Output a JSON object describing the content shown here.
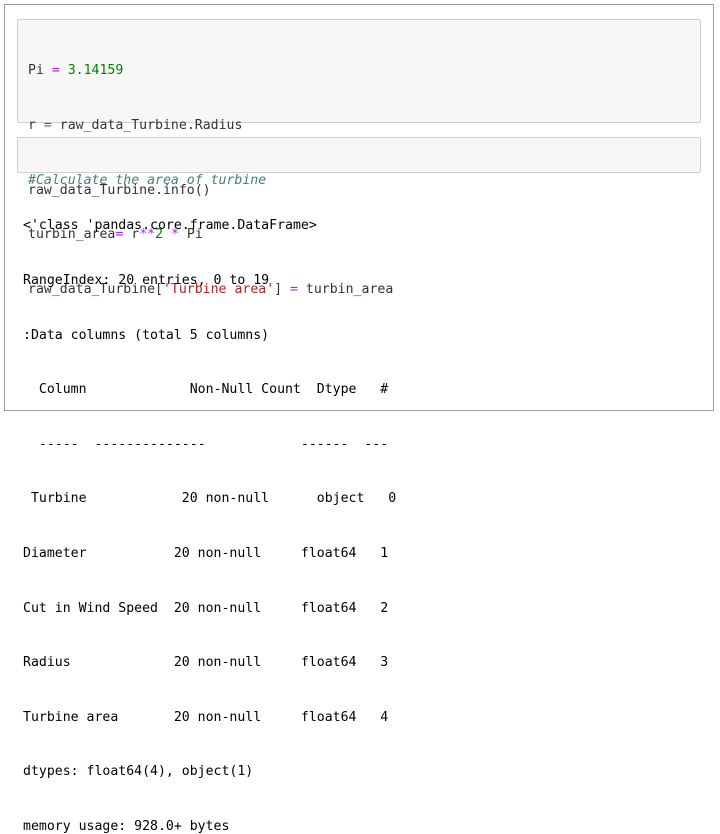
{
  "cell1": {
    "line1": {
      "a": "Pi ",
      "b": "=",
      "c": " ",
      "d": "3.14159"
    },
    "line2": {
      "a": "r ",
      "b": "=",
      "c": " raw_data_Turbine.Radius"
    },
    "line3": {
      "a": "#Calculate the area of turbine"
    },
    "line4": {
      "a": "turbin_area",
      "b": "=",
      "c": " r",
      "d": "**",
      "e": "2",
      "f": " ",
      "g": "*",
      "h": " Pi"
    },
    "line5": {
      "a": "raw_data_Turbine[",
      "b": "'Turbine area'",
      "c": "] ",
      "d": "=",
      "e": " turbin_area"
    }
  },
  "cell2": {
    "line1": {
      "a": "raw_data_Turbine.info()"
    }
  },
  "output": {
    "lines": [
      "<'class 'pandas.core.frame.DataFrame>",
      "RangeIndex: 20 entries, 0 to 19",
      ":Data columns (total 5 columns)",
      "  Column             Non-Null Count  Dtype   #",
      "  -----  --------------            ------  ---",
      " Turbine            20 non-null      object   0",
      "Diameter           20 non-null     float64   1",
      "Cut in Wind Speed  20 non-null     float64   2",
      "Radius             20 non-null     float64   3",
      "Turbine area       20 non-null     float64   4",
      "dtypes: float64(4), object(1)",
      "memory usage: 928.0+ bytes"
    ]
  }
}
